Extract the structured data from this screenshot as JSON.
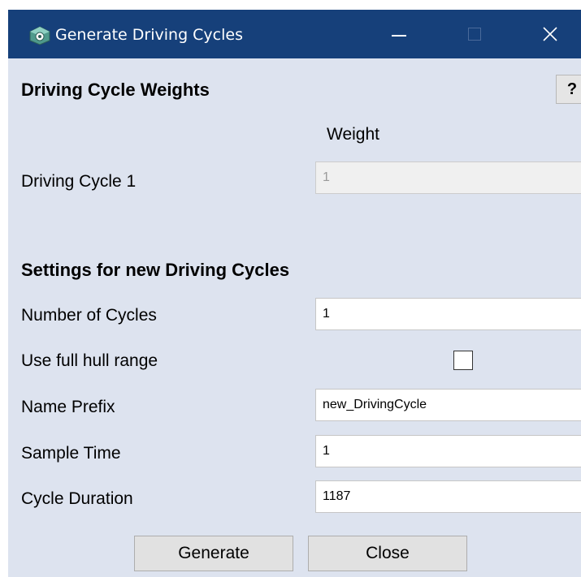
{
  "window": {
    "title": "Generate Driving Cycles",
    "icon": "app-cube-icon",
    "controls": [
      "minimize-icon",
      "maximize-icon",
      "close-icon"
    ]
  },
  "weights_section": {
    "title": "Driving Cycle Weights",
    "help_label": "?",
    "column_header": "Weight",
    "rows": [
      {
        "label": "Driving Cycle 1",
        "value": "1"
      }
    ]
  },
  "settings_section": {
    "title": "Settings for new Driving Cycles",
    "number_of_cycles": {
      "label": "Number of Cycles",
      "value": "1"
    },
    "use_full_hull_range": {
      "label": "Use full hull range",
      "checked": false
    },
    "name_prefix": {
      "label": "Name Prefix",
      "value": "new_DrivingCycle"
    },
    "sample_time": {
      "label": "Sample Time",
      "value": "1"
    },
    "cycle_duration": {
      "label": "Cycle Duration",
      "value": "1187"
    }
  },
  "buttons": {
    "generate": "Generate",
    "close": "Close"
  },
  "colors": {
    "titlebar": "#16407a",
    "dialog_bg": "#dde3ef"
  }
}
